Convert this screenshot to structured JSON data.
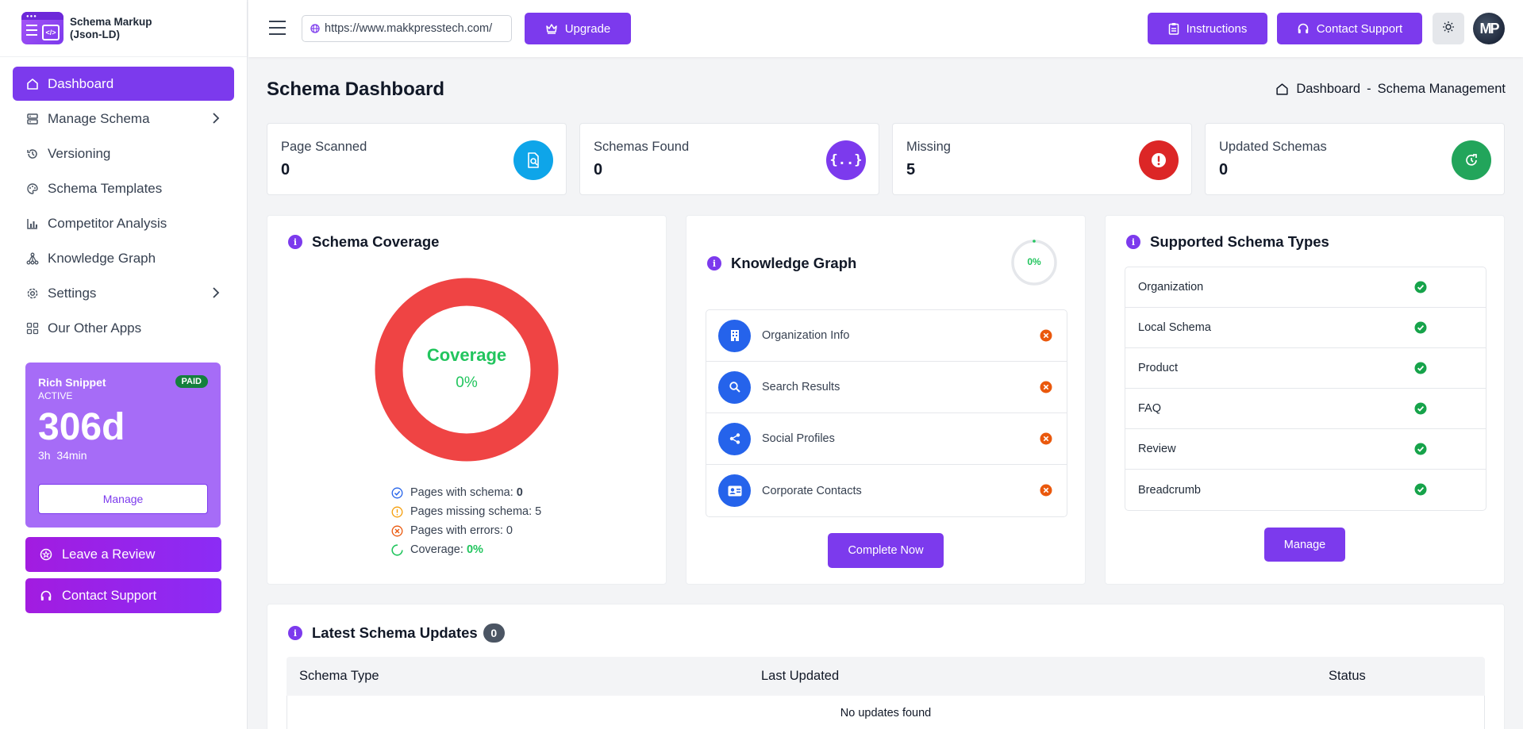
{
  "app": {
    "name_line1": "Schema Markup",
    "name_line2": "(Json-LD)"
  },
  "sidebar": {
    "items": [
      {
        "label": "Dashboard",
        "icon": "home-icon"
      },
      {
        "label": "Manage Schema",
        "icon": "server-icon"
      },
      {
        "label": "Versioning",
        "icon": "history-icon"
      },
      {
        "label": "Schema Templates",
        "icon": "palette-icon"
      },
      {
        "label": "Competitor Analysis",
        "icon": "bar-chart-icon"
      },
      {
        "label": "Knowledge Graph",
        "icon": "graph-icon"
      },
      {
        "label": "Settings",
        "icon": "gear-icon"
      },
      {
        "label": "Our Other Apps",
        "icon": "apps-icon"
      }
    ],
    "plan": {
      "title": "Rich Snippet",
      "status": "ACTIVE",
      "badge": "PAID",
      "days": "306d",
      "time": "3h  34min",
      "manage_label": "Manage"
    },
    "review_label": "Leave a Review",
    "support_label": "Contact Support"
  },
  "header": {
    "url": "https://www.makkpresstech.com/",
    "upgrade_label": "Upgrade",
    "instructions_label": "Instructions",
    "support_label": "Contact Support",
    "avatar_initials": "MP"
  },
  "page": {
    "title": "Schema Dashboard",
    "breadcrumb_home": "Dashboard",
    "breadcrumb_sep": "-",
    "breadcrumb_current": "Schema Management"
  },
  "stats": [
    {
      "label": "Page Scanned",
      "value": "0",
      "color": "#0ea5e9"
    },
    {
      "label": "Schemas Found",
      "value": "0",
      "color": "#7c3aed"
    },
    {
      "label": "Missing",
      "value": "5",
      "color": "#dc2626"
    },
    {
      "label": "Updated Schemas",
      "value": "0",
      "color": "#22a55b"
    }
  ],
  "coverage": {
    "title": "Schema Coverage",
    "center_label": "Coverage",
    "center_value": "0%",
    "percent": 0,
    "legend": [
      {
        "label": "Pages with schema: ",
        "value": "0"
      },
      {
        "label": "Pages missing schema: ",
        "value": "5"
      },
      {
        "label": "Pages with errors: ",
        "value": "0"
      },
      {
        "label": "Coverage: ",
        "value": "0%"
      }
    ]
  },
  "knowledge_graph": {
    "title": "Knowledge Graph",
    "progress_label": "0%",
    "progress": 0,
    "items": [
      {
        "label": "Organization Info",
        "icon": "building-icon"
      },
      {
        "label": "Search Results",
        "icon": "search-icon"
      },
      {
        "label": "Social Profiles",
        "icon": "share-icon"
      },
      {
        "label": "Corporate Contacts",
        "icon": "contact-card-icon"
      }
    ],
    "button_label": "Complete Now"
  },
  "supported_types": {
    "title": "Supported Schema Types",
    "items": [
      "Organization",
      "Local Schema",
      "Product",
      "FAQ",
      "Review",
      "Breadcrumb"
    ],
    "button_label": "Manage"
  },
  "updates": {
    "title": "Latest Schema Updates",
    "count": "0",
    "columns": [
      "Schema Type",
      "Last Updated",
      "Status"
    ],
    "empty_text": "No updates found"
  },
  "colors": {
    "accent": "#7c3aed",
    "danger": "#ef4444",
    "success": "#22c55e"
  }
}
